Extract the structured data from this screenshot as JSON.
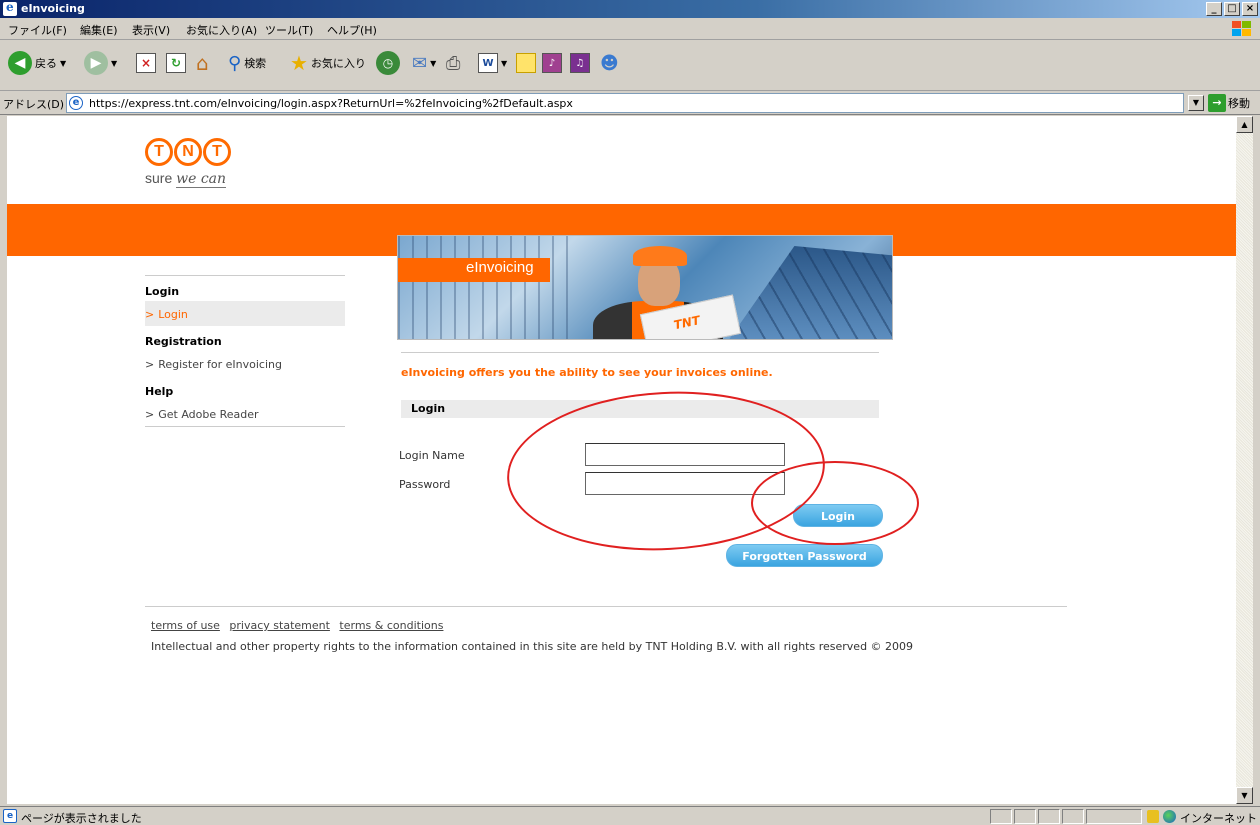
{
  "window": {
    "title": "eInvoicing",
    "controls": [
      "_",
      "□",
      "×"
    ]
  },
  "menu": [
    "ファイル(F)",
    "編集(E)",
    "表示(V)",
    "お気に入り(A)",
    "ツール(T)",
    "ヘルプ(H)"
  ],
  "toolbar": {
    "back": "戻る",
    "search": "検索",
    "favorites": "お気に入り"
  },
  "address": {
    "label": "アドレス(D)",
    "url": "https://express.tnt.com/eInvoicing/login.aspx?ReturnUrl=%2feInvoicing%2fDefault.aspx",
    "go": "移動"
  },
  "logo": {
    "letters": [
      "T",
      "N",
      "T"
    ],
    "tagline_prefix": "sure",
    "tagline_em": "we can"
  },
  "banner": {
    "title": "eInvoicing",
    "box_text": "TNT"
  },
  "nav": [
    {
      "type": "heading",
      "label": "Login"
    },
    {
      "type": "item",
      "label": "Login",
      "active": true
    },
    {
      "type": "heading",
      "label": "Registration"
    },
    {
      "type": "item",
      "label": "Register for eInvoicing",
      "active": false
    },
    {
      "type": "heading",
      "label": "Help"
    },
    {
      "type": "item",
      "label": "Get Adobe Reader",
      "active": false
    }
  ],
  "main": {
    "intro": "eInvoicing offers you the ability to see your invoices online.",
    "section_title": "Login",
    "login_name_label": "Login Name",
    "password_label": "Password",
    "login_name_value": "",
    "password_value": "",
    "login_button": "Login",
    "forgot_button": "Forgotten Password"
  },
  "footer": {
    "links": [
      "terms of use",
      "privacy statement",
      "terms & conditions"
    ],
    "copyright": "Intellectual and other property rights to the information contained in this site are held by TNT Holding B.V. with all rights reserved © 2009"
  },
  "status": {
    "text": "ページが表示されました",
    "zone": "インターネット"
  },
  "colors": {
    "tnt_orange": "#ff6600",
    "button_blue": "#3aa4e0",
    "annotation_red": "#e02020"
  }
}
